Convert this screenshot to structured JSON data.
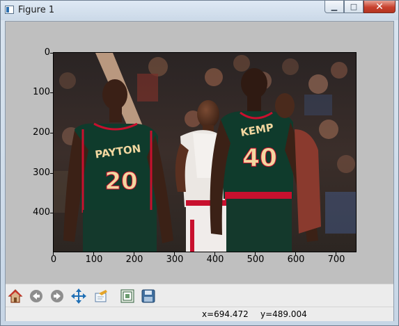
{
  "window": {
    "title": "Figure 1",
    "minimize_glyph": "▁",
    "maximize_glyph": "□",
    "close_glyph": "✕"
  },
  "plot": {
    "y_ticks": [
      "0",
      "100",
      "200",
      "300",
      "400"
    ],
    "x_ticks": [
      "0",
      "100",
      "200",
      "300",
      "400",
      "500",
      "600",
      "700"
    ]
  },
  "photo": {
    "description_text_on_jerseys": [
      "PAYTON",
      "20",
      "KEMP",
      "40"
    ]
  },
  "toolbar": {
    "buttons": [
      "home-icon",
      "back-icon",
      "forward-icon",
      "pan-icon",
      "zoom-icon",
      "configure-subplots-icon",
      "save-icon"
    ]
  },
  "status": {
    "x_readout": "x=694.472",
    "y_readout": "y=489.004"
  },
  "colors": {
    "canvas_bg": "#bfbfbf",
    "sonics_green": "#0f3b2c",
    "sonics_gold": "#f2d7a0",
    "bulls_red": "#c8102e"
  }
}
